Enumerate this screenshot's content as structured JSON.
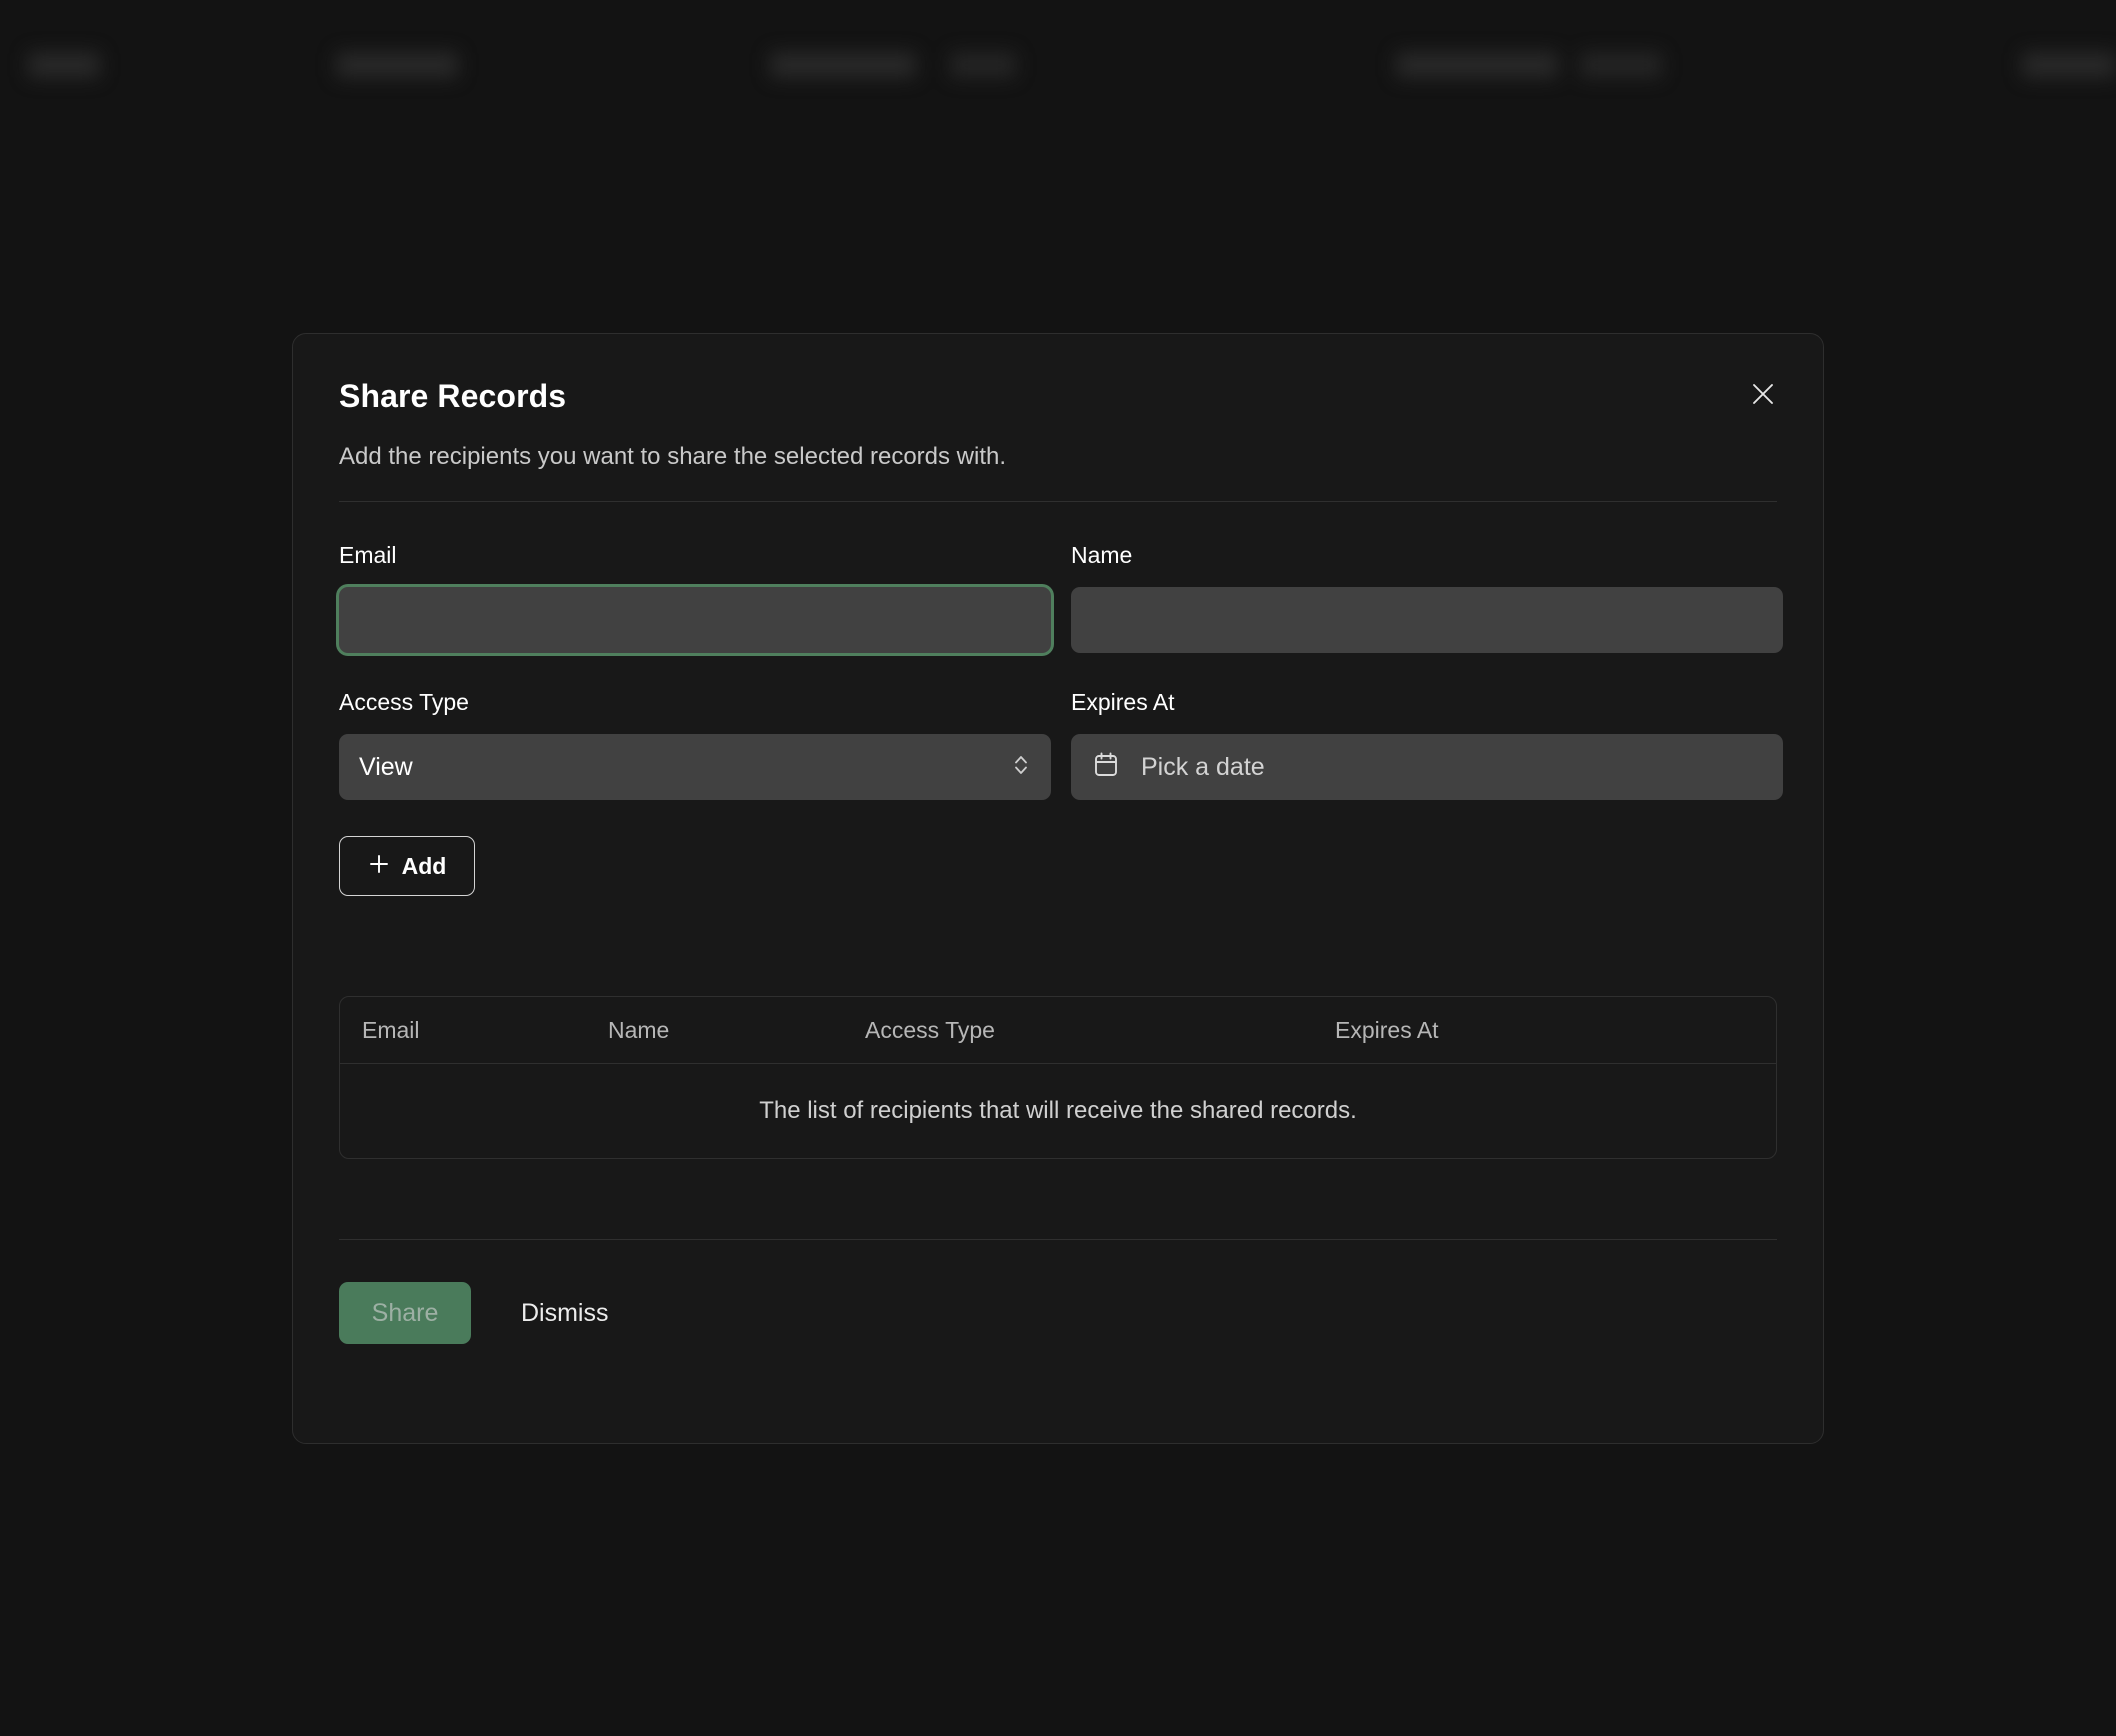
{
  "modal": {
    "title": "Share Records",
    "subtitle": "Add the recipients you want to share the selected records with.",
    "close_icon": "close-icon",
    "accent_color": "#4a7b5b",
    "focus_ring_color": "#4f7f5d"
  },
  "form": {
    "email": {
      "label": "Email",
      "value": "",
      "placeholder": "",
      "focused": true
    },
    "name": {
      "label": "Name",
      "value": "",
      "placeholder": "",
      "focused": false
    },
    "access_type": {
      "label": "Access Type",
      "selected": "View",
      "icon": "chevron-up-down-icon"
    },
    "expires_at": {
      "label": "Expires At",
      "placeholder": "Pick a date",
      "icon": "calendar-icon"
    },
    "add_button": {
      "label": "Add",
      "icon": "plus-icon"
    }
  },
  "table": {
    "columns": [
      "Email",
      "Name",
      "Access Type",
      "Expires At"
    ],
    "rows": [],
    "empty_message": "The list of recipients that will receive the shared records."
  },
  "footer": {
    "share_label": "Share",
    "share_disabled": true,
    "dismiss_label": "Dismiss"
  }
}
